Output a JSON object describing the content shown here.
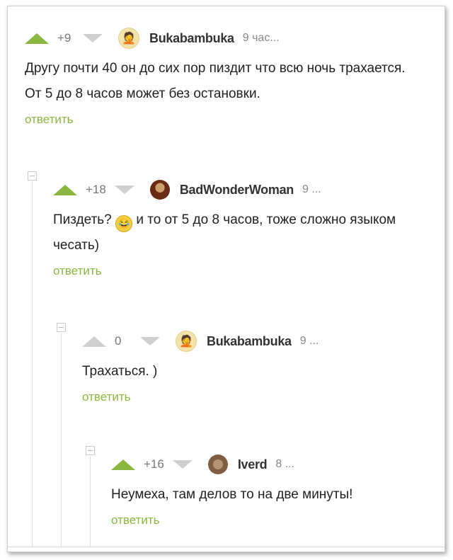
{
  "comments": [
    {
      "rating": "+9",
      "username": "Bukabambuka",
      "time": "9 час...",
      "text": "Другу почти 40 он до сих пор пиздит что всю ночь трахается. От 5 до 8 часов может без остановки.",
      "reply": "ответить",
      "avatar_icon": "facepalm-avatar"
    },
    {
      "rating": "+18",
      "username": "BadWonderWoman",
      "time": "9 ...",
      "text_before_emoji": "Пиздеть?",
      "emoji": "😂",
      "text_after_emoji": "и то от 5 до 8 часов, тоже сложно языком чесать)",
      "reply": "ответить",
      "avatar_icon": "portrait-avatar"
    },
    {
      "rating": "0",
      "username": "Bukabambuka",
      "time": "9 ...",
      "text": "Трахаться. )",
      "reply": "ответить",
      "avatar_icon": "facepalm-avatar"
    },
    {
      "rating": "+16",
      "username": "Iverd",
      "time": "8 ...",
      "text": "Неумеха, там делов то на две минуты!",
      "reply": "ответить",
      "avatar_icon": "cat-avatar"
    }
  ],
  "colors": {
    "accent_green": "#8ab73f",
    "vote_gray": "#cfcfcf",
    "text": "#222222",
    "meta": "#888888"
  }
}
